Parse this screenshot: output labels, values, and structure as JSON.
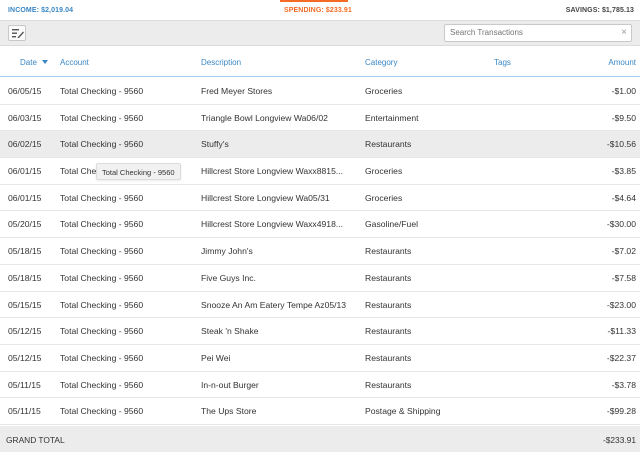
{
  "summary": {
    "income": "INCOME: $2,019.04",
    "spending": "SPENDING: $233.91",
    "savings": "SAVINGS: $1,785.13"
  },
  "colors": {
    "income": "#3a87c5",
    "spending": "#f36b26",
    "header": "#3a87c5"
  },
  "toolbar": {
    "search_placeholder": "Search Transactions",
    "clear_glyph": "×"
  },
  "columns": {
    "date": "Date",
    "account": "Account",
    "description": "Description",
    "category": "Category",
    "tags": "Tags",
    "amount": "Amount"
  },
  "sort": {
    "column": "date",
    "direction": "descending"
  },
  "transactions": [
    {
      "date": "06/05/15",
      "account": "Total Checking - 9560",
      "description": "Fred Meyer Stores",
      "category": "Groceries",
      "amount": "-$1.00"
    },
    {
      "date": "06/03/15",
      "account": "Total Checking - 9560",
      "description": "Triangle Bowl Longview Wa06/02",
      "category": "Entertainment",
      "amount": "-$9.50"
    },
    {
      "date": "06/02/15",
      "account": "Total Checking - 9560",
      "description": "Stuffy's",
      "category": "Restaurants",
      "amount": "-$10.56"
    },
    {
      "date": "06/01/15",
      "account": "Total Che",
      "description": "Hillcrest Store Longview Waxx8815...",
      "category": "Groceries",
      "amount": "-$3.85"
    },
    {
      "date": "06/01/15",
      "account": "Total Checking - 9560",
      "description": "Hillcrest Store Longview Wa05/31",
      "category": "Groceries",
      "amount": "-$4.64"
    },
    {
      "date": "05/20/15",
      "account": "Total Checking - 9560",
      "description": "Hillcrest Store Longview Waxx4918...",
      "category": "Gasoline/Fuel",
      "amount": "-$30.00"
    },
    {
      "date": "05/18/15",
      "account": "Total Checking - 9560",
      "description": "Jimmy John's",
      "category": "Restaurants",
      "amount": "-$7.02"
    },
    {
      "date": "05/18/15",
      "account": "Total Checking - 9560",
      "description": "Five Guys Inc.",
      "category": "Restaurants",
      "amount": "-$7.58"
    },
    {
      "date": "05/15/15",
      "account": "Total Checking - 9560",
      "description": "Snooze An Am Eatery Tempe Az05/13",
      "category": "Restaurants",
      "amount": "-$23.00"
    },
    {
      "date": "05/12/15",
      "account": "Total Checking - 9560",
      "description": "Steak 'n Shake",
      "category": "Restaurants",
      "amount": "-$11.33"
    },
    {
      "date": "05/12/15",
      "account": "Total Checking - 9560",
      "description": "Pei Wei",
      "category": "Restaurants",
      "amount": "-$22.37"
    },
    {
      "date": "05/11/15",
      "account": "Total Checking - 9560",
      "description": "In-n-out Burger",
      "category": "Restaurants",
      "amount": "-$3.78"
    },
    {
      "date": "05/11/15",
      "account": "Total Checking - 9560",
      "description": "The Ups Store",
      "category": "Postage & Shipping",
      "amount": "-$99.28"
    }
  ],
  "tooltip": {
    "text": "Total Checking - 9560"
  },
  "grand_total": {
    "label": "GRAND TOTAL",
    "value": "-$233.91"
  }
}
